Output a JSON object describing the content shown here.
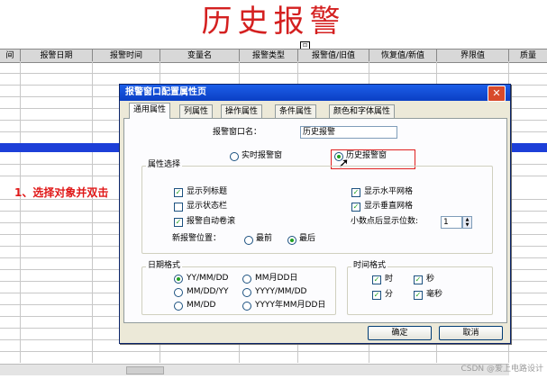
{
  "page": {
    "title": "历史报警",
    "title_marker": "⊡",
    "instruction": "1、选择对象并双击",
    "watermark": "CSDN @爱上电路设计",
    "columns": [
      "间",
      "报警日期",
      "报警时间",
      "变量名",
      "报警类型",
      "报警值/旧值",
      "恢复值/新值",
      "界限值",
      "质量"
    ]
  },
  "dialog": {
    "title": "报警窗口配置属性页",
    "close_glyph": "✕",
    "tabs": [
      "通用属性",
      "列属性",
      "操作属性",
      "条件属性",
      "颜色和字体属性"
    ],
    "window_name_label": "报警窗口名：",
    "window_name_value": "历史报警",
    "mode_realtime": "实时报警窗",
    "mode_history": "历史报警窗",
    "props_group": "属性选择",
    "show_col_title": "显示列标题",
    "show_status_bar": "显示状态栏",
    "auto_scroll": "报警自动卷滚",
    "show_h_grid": "显示水平网格",
    "show_v_grid": "显示垂直网格",
    "decimal_label": "小数点后显示位数:",
    "decimal_value": "1",
    "new_alarm_pos_label": "新报警位置：",
    "pos_first": "最前",
    "pos_last": "最后",
    "date_group": "日期格式",
    "date_fmt_1": "YY/MM/DD",
    "date_fmt_2": "MM月DD日",
    "date_fmt_3": "MM/DD/YY",
    "date_fmt_4": "YYYY/MM/DD",
    "date_fmt_5": "MM/DD",
    "date_fmt_6": "YYYY年MM月DD日",
    "time_group": "时间格式",
    "time_hour": "时",
    "time_sec": "秒",
    "time_min": "分",
    "time_ms": "毫秒",
    "ok": "确定",
    "cancel": "取消",
    "check_mark": "✓"
  }
}
